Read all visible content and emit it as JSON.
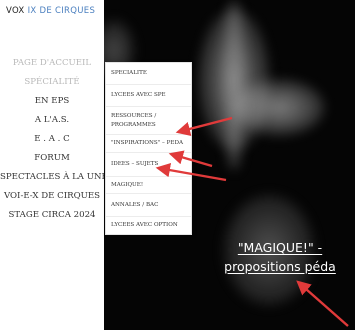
{
  "site": {
    "logo_part1": "VO",
    "logo_part2": "IX DE CIRQUES"
  },
  "nav": {
    "items": [
      {
        "label": "Page d'accueil",
        "muted": true
      },
      {
        "label": "Spécialité",
        "muted": true
      },
      {
        "label": "En EPS",
        "muted": false
      },
      {
        "label": "A l'A.S.",
        "muted": false
      },
      {
        "label": "E . A . C",
        "muted": false
      },
      {
        "label": "Forum",
        "muted": false
      },
      {
        "label": "Spectacles à la une",
        "muted": false
      },
      {
        "label": "Voi-E-X de cirques",
        "muted": false
      },
      {
        "label": "Stage CIRCA 2024",
        "muted": false
      }
    ]
  },
  "dropdown": {
    "items": [
      {
        "label": "Specialite"
      },
      {
        "label": "Lycees avec SPE"
      },
      {
        "label": "Ressources / Programmes"
      },
      {
        "label": "\"Inspirations\" – Peda"
      },
      {
        "label": "Idees – Sujets"
      },
      {
        "label": "Magique!"
      },
      {
        "label": "Annales / Bac"
      },
      {
        "label": "Lycees avec option"
      }
    ]
  },
  "caption": {
    "line1": "\"MAGIQUE!\" -",
    "line2": "propositions péda"
  },
  "colors": {
    "accent": "#4a7fbf",
    "arrow": "#e03a3a",
    "stage_bg": "#050505"
  }
}
